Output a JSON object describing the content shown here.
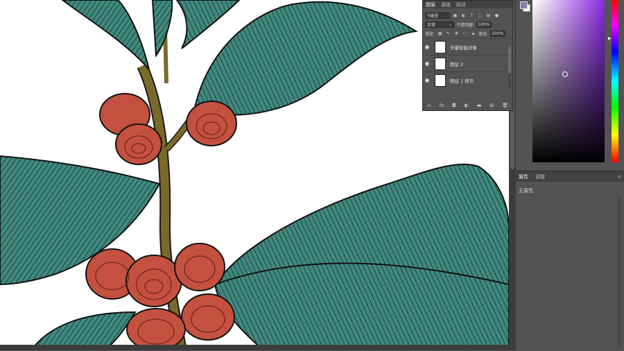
{
  "layers_panel": {
    "tabs": [
      "图层",
      "通道",
      "路径"
    ],
    "filter_kind": "类型",
    "blend_mode": "正常",
    "opacity_label": "不透明度:",
    "opacity_value": "100%",
    "lock_label": "锁定:",
    "fill_label": "填充:",
    "fill_value": "100%",
    "layers": [
      {
        "name": "矢量智能对象",
        "visible": true
      },
      {
        "name": "图层 2",
        "visible": true
      },
      {
        "name": "图层 1 拷贝",
        "visible": true
      }
    ]
  },
  "color_picker": {
    "foreground": "#8a7ba6",
    "background": "#ffffff"
  },
  "properties_panel": {
    "tabs": [
      "属性",
      "调整"
    ],
    "empty_text": "无属性"
  },
  "artwork": {
    "leaf_color": "#3f8a80",
    "berry_color": "#c4503f",
    "stem_color": "#7a6a2a"
  }
}
